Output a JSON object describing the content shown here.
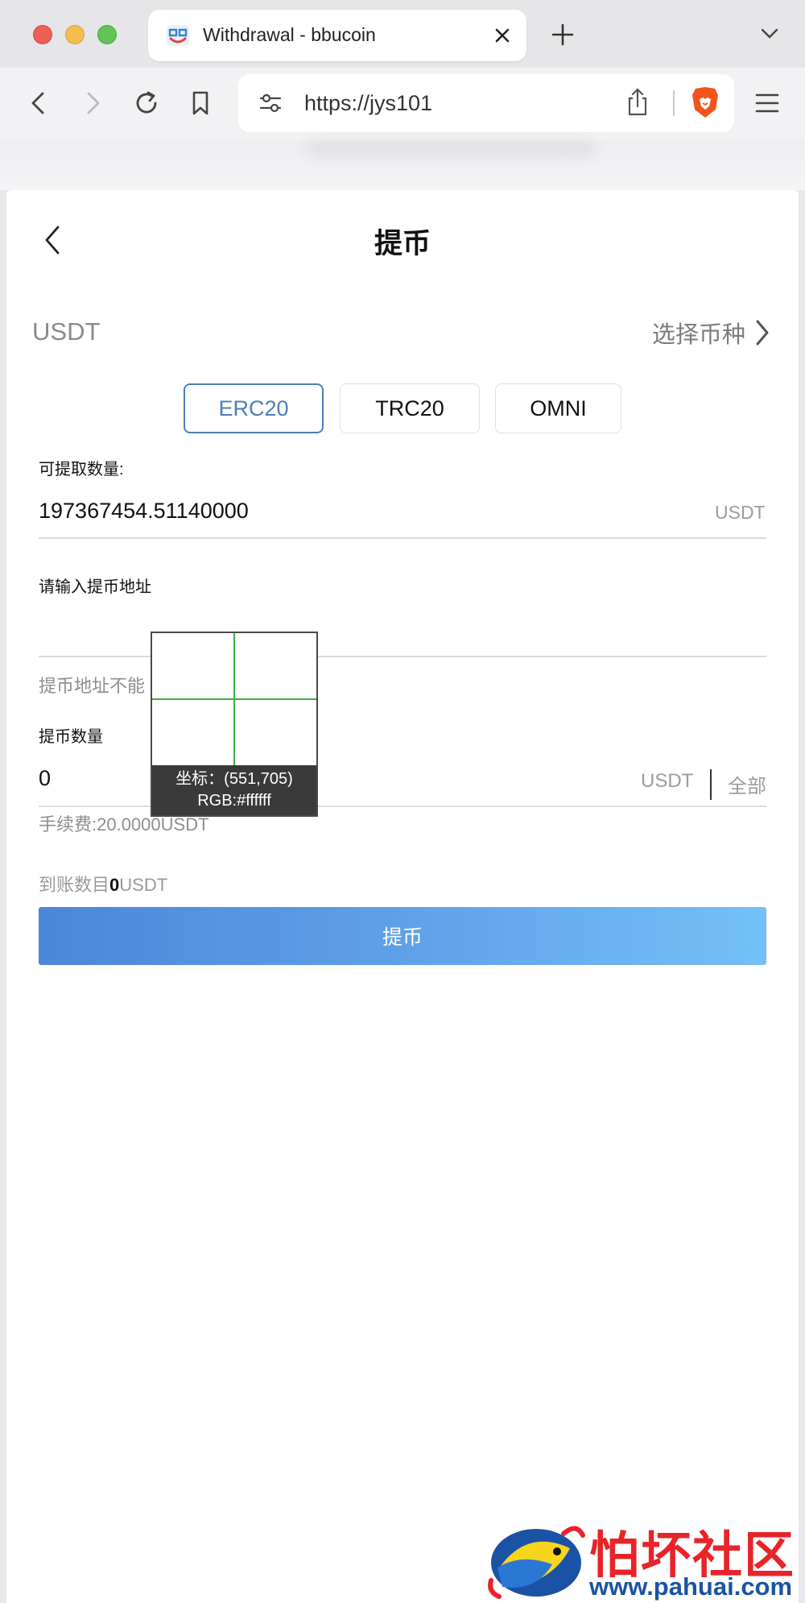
{
  "browser": {
    "tab_title": "Withdrawal - bbucoin",
    "url": "https://jys101"
  },
  "page": {
    "title": "提币",
    "coin": {
      "name": "USDT",
      "select_label": "选择币种"
    },
    "chains": [
      {
        "label": "ERC20",
        "active": true
      },
      {
        "label": "TRC20",
        "active": false
      },
      {
        "label": "OMNI",
        "active": false
      }
    ],
    "balance": {
      "label": "可提取数量:",
      "value": "197367454.51140000",
      "unit": "USDT"
    },
    "address": {
      "label": "请输入提币地址",
      "value": "",
      "error": "提币地址不能"
    },
    "amount": {
      "label": "提币数量",
      "value": "0",
      "unit": "USDT",
      "all_label": "全部"
    },
    "fee_text": "手续费:20.0000USDT",
    "arrive": {
      "prefix": "到账数目",
      "value": "0",
      "suffix": "USDT"
    },
    "submit_label": "提币"
  },
  "magnifier": {
    "coord_text": "坐标：(551,705)",
    "rgb_text": "RGB:#ffffff"
  },
  "watermark": {
    "name": "怕坏社区",
    "url": "www.pahuai.com"
  },
  "colors": {
    "accent": "#4a80b7",
    "button_gradient_start": "#4a87d9",
    "button_gradient_end": "#74c0f7",
    "watermark_red": "#e8232a",
    "watermark_blue": "#1a53a6"
  }
}
